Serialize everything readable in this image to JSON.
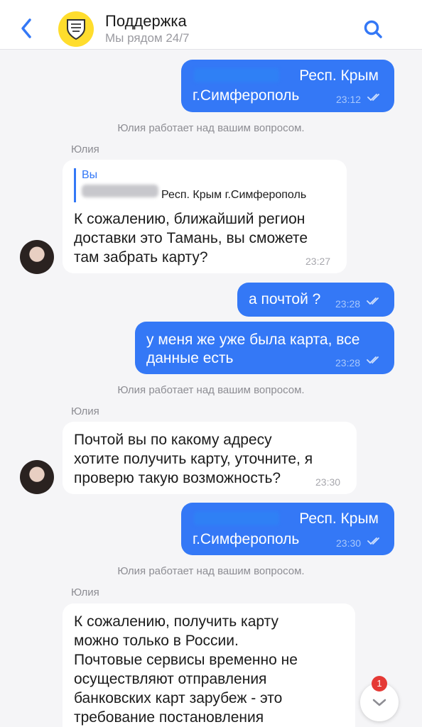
{
  "header": {
    "title": "Поддержка",
    "subtitle": "Мы рядом 24/7"
  },
  "messages": [
    {
      "id": "m1",
      "text_line1": "Респ. Крым",
      "text_line2": "г.Симферополь",
      "time": "23:12"
    },
    {
      "id": "sys1",
      "text": "Юлия работает над вашим вопросом."
    },
    {
      "id": "m2",
      "sender": "Юлия",
      "quote_author": "Вы",
      "quote_text": "Респ. Крым г.Симферополь",
      "lines": [
        "К сожалению, ближайший регион",
        "доставки это Тамань, вы сможете",
        "там забрать карту?"
      ],
      "time": "23:27"
    },
    {
      "id": "m3",
      "text": "а почтой ?",
      "time": "23:28"
    },
    {
      "id": "m4",
      "lines": [
        "у меня же уже была карта, все",
        "данные есть"
      ],
      "time": "23:28"
    },
    {
      "id": "sys2",
      "text": "Юлия работает над вашим вопросом."
    },
    {
      "id": "m5",
      "sender": "Юлия",
      "lines": [
        "Почтой вы по какому адресу",
        "хотите получить карту, уточните, я",
        "проверю такую возможность?"
      ],
      "time": "23:30"
    },
    {
      "id": "m6",
      "text_line1": "Респ. Крым",
      "text_line2": "г.Симферополь",
      "time": "23:30"
    },
    {
      "id": "sys3",
      "text": "Юлия работает над вашим вопросом."
    },
    {
      "id": "m7",
      "sender": "Юлия",
      "lines": [
        "К сожалению, получить карту",
        "можно только в России.",
        "Почтовые сервисы временно не",
        "осуществляют отправления",
        "банковских карт зарубеж - это",
        "требование постановления"
      ]
    }
  ],
  "scroll_badge": "1",
  "colors": {
    "accent": "#3478f6",
    "background": "#f5f5f7",
    "logo": "#ffdd2d",
    "badge": "#e53935"
  }
}
